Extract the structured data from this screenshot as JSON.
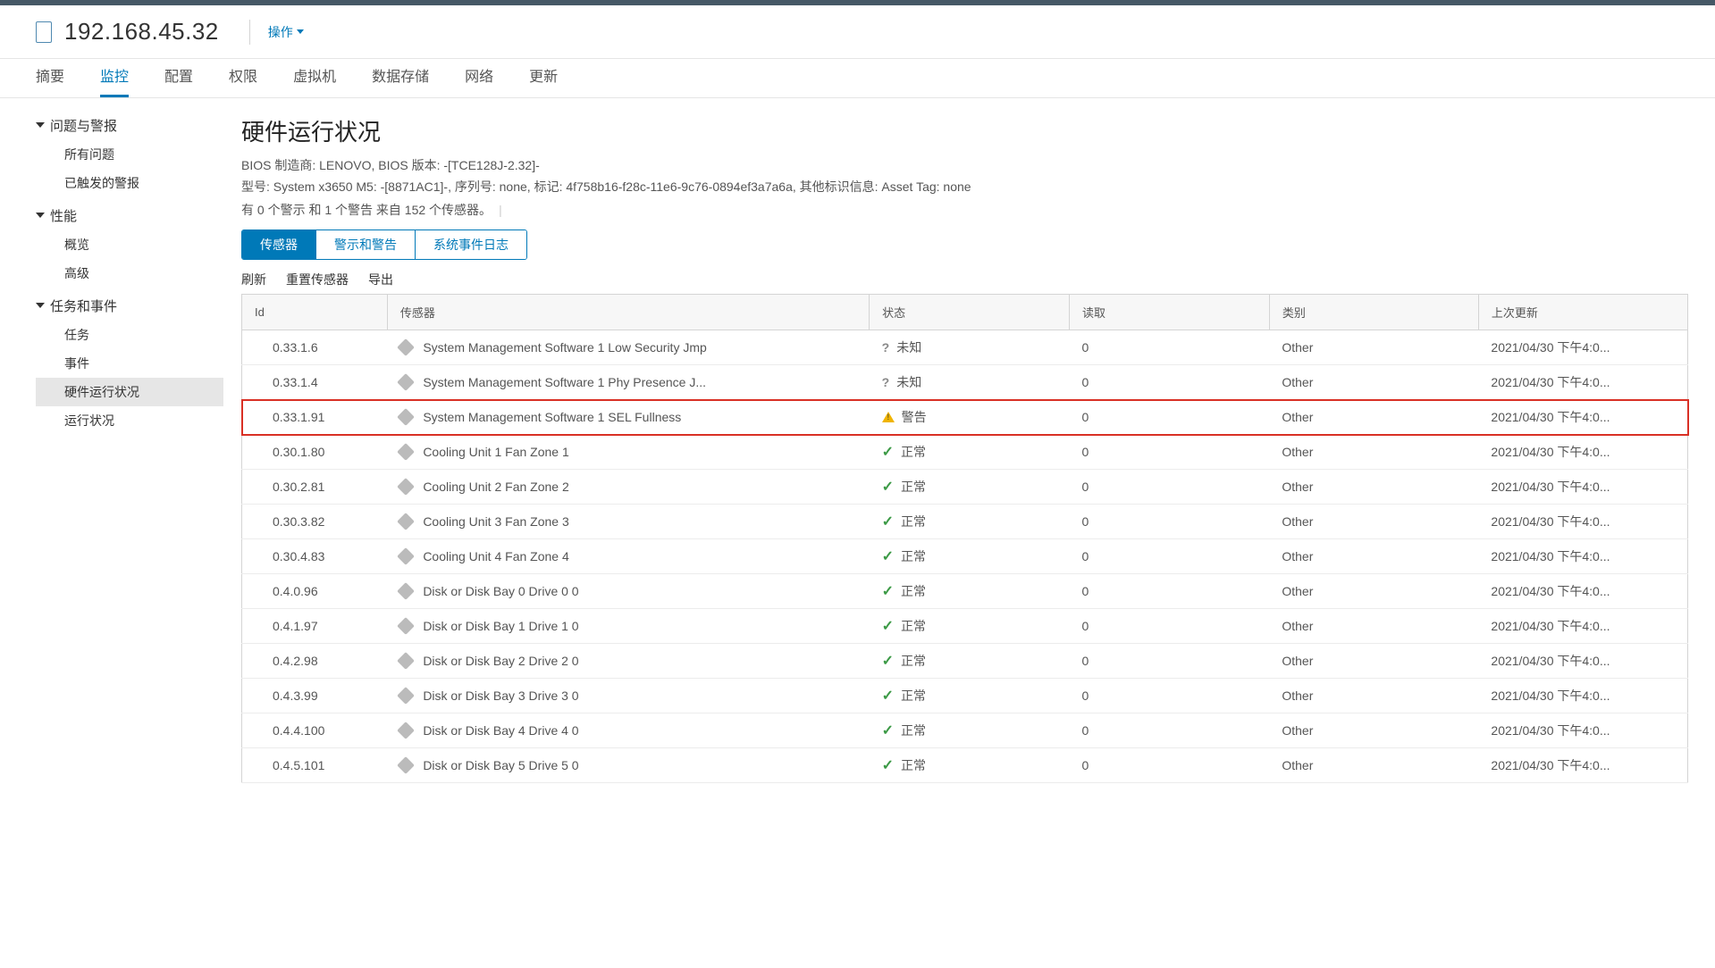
{
  "header": {
    "host_ip": "192.168.45.32",
    "actions_label": "操作"
  },
  "main_tabs": [
    "摘要",
    "监控",
    "配置",
    "权限",
    "虚拟机",
    "数据存储",
    "网络",
    "更新"
  ],
  "main_tab_active_index": 1,
  "sidebar": {
    "groups": [
      {
        "label": "问题与警报",
        "items": [
          "所有问题",
          "已触发的警报"
        ]
      },
      {
        "label": "性能",
        "items": [
          "概览",
          "高级"
        ]
      },
      {
        "label": "任务和事件",
        "items": [
          "任务",
          "事件",
          "硬件运行状况",
          "运行状况"
        ],
        "selected_index": 2
      }
    ]
  },
  "page": {
    "title": "硬件运行状况",
    "bios_line": "BIOS 制造商: LENOVO, BIOS 版本: -[TCE128J-2.32]-",
    "model_line": "型号: System x3650 M5: -[8871AC1]-, 序列号: none, 标记: 4f758b16-f28c-11e6-9c76-0894ef3a7a6a, 其他标识信息: Asset Tag: none",
    "sensor_summary": "有 0 个警示 和 1 个警告 来自 152 个传感器。"
  },
  "segments": [
    "传感器",
    "警示和警告",
    "系统事件日志"
  ],
  "segment_active_index": 0,
  "actions": [
    "刷新",
    "重置传感器",
    "导出"
  ],
  "columns": {
    "id": "Id",
    "sensor": "传感器",
    "status": "状态",
    "read": "读取",
    "category": "类别",
    "last_update": "上次更新"
  },
  "status_labels": {
    "unknown": "未知",
    "warning": "警告",
    "ok": "正常"
  },
  "rows": [
    {
      "id": "0.33.1.6",
      "sensor": "System Management Software 1 Low Security Jmp",
      "status": "unknown",
      "read": "0",
      "cat": "Other",
      "time": "2021/04/30 下午4:0..."
    },
    {
      "id": "0.33.1.4",
      "sensor": "System Management Software 1 Phy Presence J...",
      "status": "unknown",
      "read": "0",
      "cat": "Other",
      "time": "2021/04/30 下午4:0..."
    },
    {
      "id": "0.33.1.91",
      "sensor": "System Management Software 1 SEL Fullness",
      "status": "warning",
      "read": "0",
      "cat": "Other",
      "time": "2021/04/30 下午4:0...",
      "highlight": true
    },
    {
      "id": "0.30.1.80",
      "sensor": "Cooling Unit 1 Fan Zone 1",
      "status": "ok",
      "read": "0",
      "cat": "Other",
      "time": "2021/04/30 下午4:0..."
    },
    {
      "id": "0.30.2.81",
      "sensor": "Cooling Unit 2 Fan Zone 2",
      "status": "ok",
      "read": "0",
      "cat": "Other",
      "time": "2021/04/30 下午4:0..."
    },
    {
      "id": "0.30.3.82",
      "sensor": "Cooling Unit 3 Fan Zone 3",
      "status": "ok",
      "read": "0",
      "cat": "Other",
      "time": "2021/04/30 下午4:0..."
    },
    {
      "id": "0.30.4.83",
      "sensor": "Cooling Unit 4 Fan Zone 4",
      "status": "ok",
      "read": "0",
      "cat": "Other",
      "time": "2021/04/30 下午4:0..."
    },
    {
      "id": "0.4.0.96",
      "sensor": "Disk or Disk Bay 0 Drive 0 0",
      "status": "ok",
      "read": "0",
      "cat": "Other",
      "time": "2021/04/30 下午4:0..."
    },
    {
      "id": "0.4.1.97",
      "sensor": "Disk or Disk Bay 1 Drive 1 0",
      "status": "ok",
      "read": "0",
      "cat": "Other",
      "time": "2021/04/30 下午4:0..."
    },
    {
      "id": "0.4.2.98",
      "sensor": "Disk or Disk Bay 2 Drive 2 0",
      "status": "ok",
      "read": "0",
      "cat": "Other",
      "time": "2021/04/30 下午4:0..."
    },
    {
      "id": "0.4.3.99",
      "sensor": "Disk or Disk Bay 3 Drive 3 0",
      "status": "ok",
      "read": "0",
      "cat": "Other",
      "time": "2021/04/30 下午4:0..."
    },
    {
      "id": "0.4.4.100",
      "sensor": "Disk or Disk Bay 4 Drive 4 0",
      "status": "ok",
      "read": "0",
      "cat": "Other",
      "time": "2021/04/30 下午4:0..."
    },
    {
      "id": "0.4.5.101",
      "sensor": "Disk or Disk Bay 5 Drive 5 0",
      "status": "ok",
      "read": "0",
      "cat": "Other",
      "time": "2021/04/30 下午4:0..."
    }
  ]
}
